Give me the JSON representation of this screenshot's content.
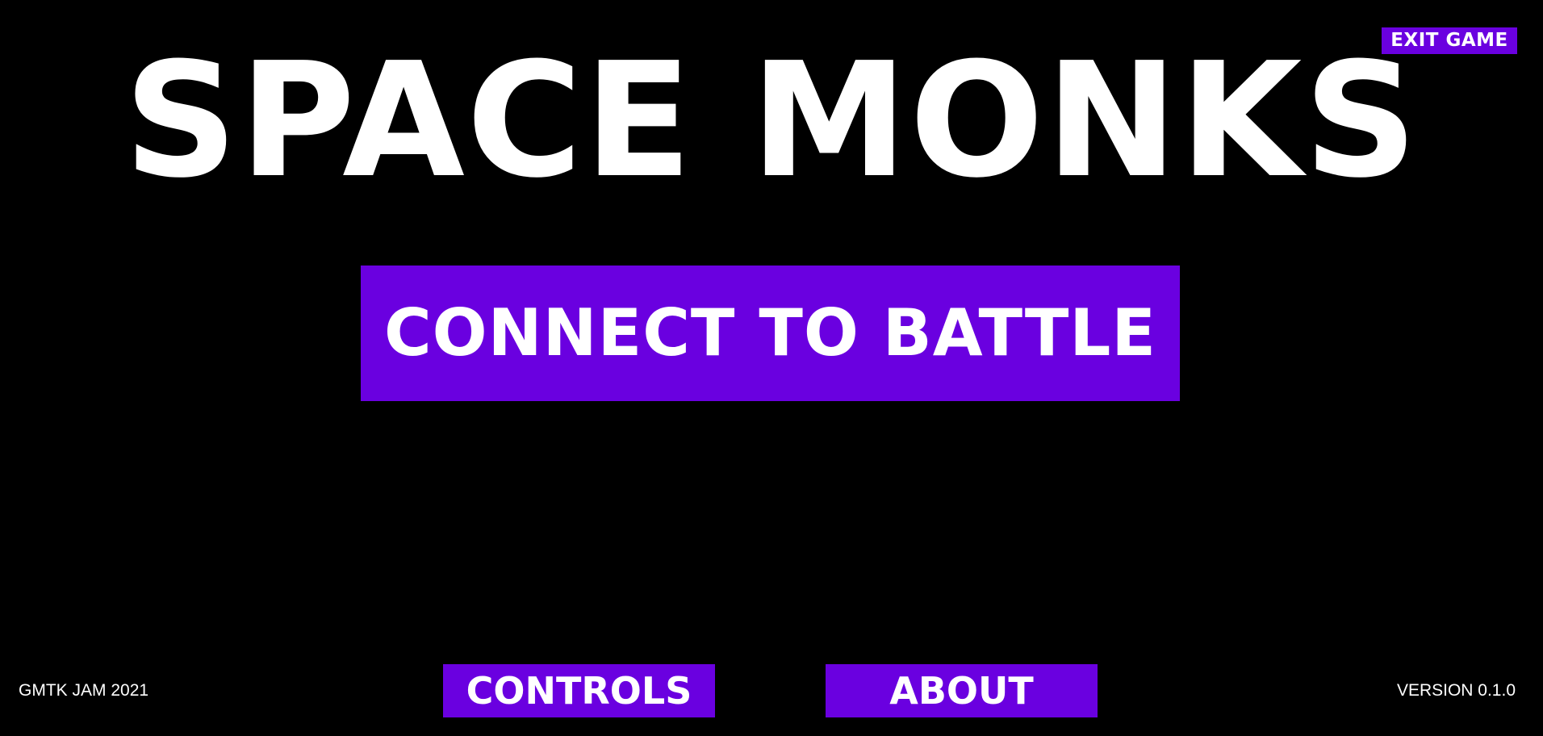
{
  "header": {
    "exit_label": "EXIT GAME"
  },
  "title": "SPACE MONKS",
  "menu": {
    "connect_label": "CONNECT TO BATTLE",
    "controls_label": "CONTROLS",
    "about_label": "ABOUT"
  },
  "footer": {
    "jam": "GMTK JAM 2021",
    "version": "VERSION 0.1.0"
  },
  "colors": {
    "background": "#000000",
    "button": "#6a00e0",
    "text": "#ffffff"
  }
}
